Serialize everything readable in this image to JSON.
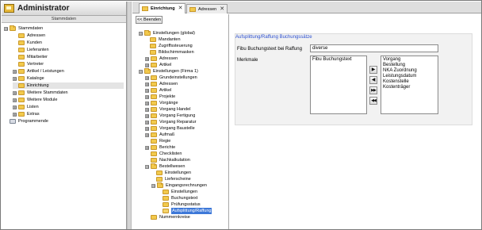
{
  "app": {
    "title": "Administrator",
    "subtitle": "Stammdaten"
  },
  "nav": {
    "items": [
      {
        "label": "Stammdaten",
        "expander": "⊟"
      },
      {
        "label": "Adressen"
      },
      {
        "label": "Kunden"
      },
      {
        "label": "Lieferanten"
      },
      {
        "label": "Mitarbeiter"
      },
      {
        "label": "Vertreter"
      },
      {
        "label": "Artikel / Leistungen",
        "expander": "⊞"
      },
      {
        "label": "Kataloge",
        "expander": "⊞"
      },
      {
        "label": "Einrichtung"
      },
      {
        "label": "Weitere Stammdaten",
        "expander": "⊞"
      },
      {
        "label": "Weitere Module",
        "expander": "⊞"
      },
      {
        "label": "Listen",
        "expander": "⊞"
      },
      {
        "label": "Extras",
        "expander": "⊞"
      },
      {
        "label": "Programmende"
      }
    ]
  },
  "tabs": [
    {
      "label": "Einrichtung",
      "close": "✕"
    },
    {
      "label": "Adressen",
      "close": "✕"
    }
  ],
  "settings_tree": {
    "back_label": "<< Beenden",
    "items": [
      {
        "label": "Einstellungen (global)",
        "expander": "⊟"
      },
      {
        "label": "Mandanten"
      },
      {
        "label": "Zugriffssteuerung"
      },
      {
        "label": "Bildschirmmasken"
      },
      {
        "label": "Adressen",
        "expander": "⊞"
      },
      {
        "label": "Artikel",
        "expander": "⊞"
      },
      {
        "label": "Einstellungen (Firma 1)",
        "expander": "⊟"
      },
      {
        "label": "Grundeinstellungen",
        "expander": "⊞"
      },
      {
        "label": "Adressen",
        "expander": "⊞"
      },
      {
        "label": "Artikel",
        "expander": "⊞"
      },
      {
        "label": "Projekte",
        "expander": "⊞"
      },
      {
        "label": "Vorgänge",
        "expander": "⊞"
      },
      {
        "label": "Vorgang Handel",
        "expander": "⊞"
      },
      {
        "label": "Vorgang Fertigung",
        "expander": "⊞"
      },
      {
        "label": "Vorgang Reparatur",
        "expander": "⊞"
      },
      {
        "label": "Vorgang Baustelle",
        "expander": "⊞"
      },
      {
        "label": "Aufmaß",
        "expander": "⊞"
      },
      {
        "label": "Regie"
      },
      {
        "label": "Berichte",
        "expander": "⊞"
      },
      {
        "label": "Checklisten"
      },
      {
        "label": "Nachkalkulation"
      },
      {
        "label": "Bestellwesen",
        "expander": "⊟"
      },
      {
        "label": "Einstellungen"
      },
      {
        "label": "Lieferscheine"
      },
      {
        "label": "Eingangsrechnungen",
        "expander": "⊟"
      },
      {
        "label": "Einstellungen"
      },
      {
        "label": "Buchungstext"
      },
      {
        "label": "Prüfungsstatus"
      },
      {
        "label": "Aufsplittung/Raffung"
      },
      {
        "label": "Nummernkreise"
      }
    ]
  },
  "content": {
    "section_title": "Aufsplittung/Raffung Buchungssätze",
    "fibu_label": "Fibu Buchungstext bei Raffung",
    "fibu_value": "diverse",
    "merkmale_label": "Merkmale",
    "selected_list": [
      "Fibu Buchungstext"
    ],
    "available_list": [
      "Vorgang",
      "Bestellung",
      "NKA Zuordnung",
      "Leistungsdatum",
      "Kostenstelle",
      "Kostenträger"
    ],
    "btn_add": "▶",
    "btn_remove": "◀",
    "btn_add_all": "▶▶",
    "btn_remove_all": "◀◀"
  }
}
